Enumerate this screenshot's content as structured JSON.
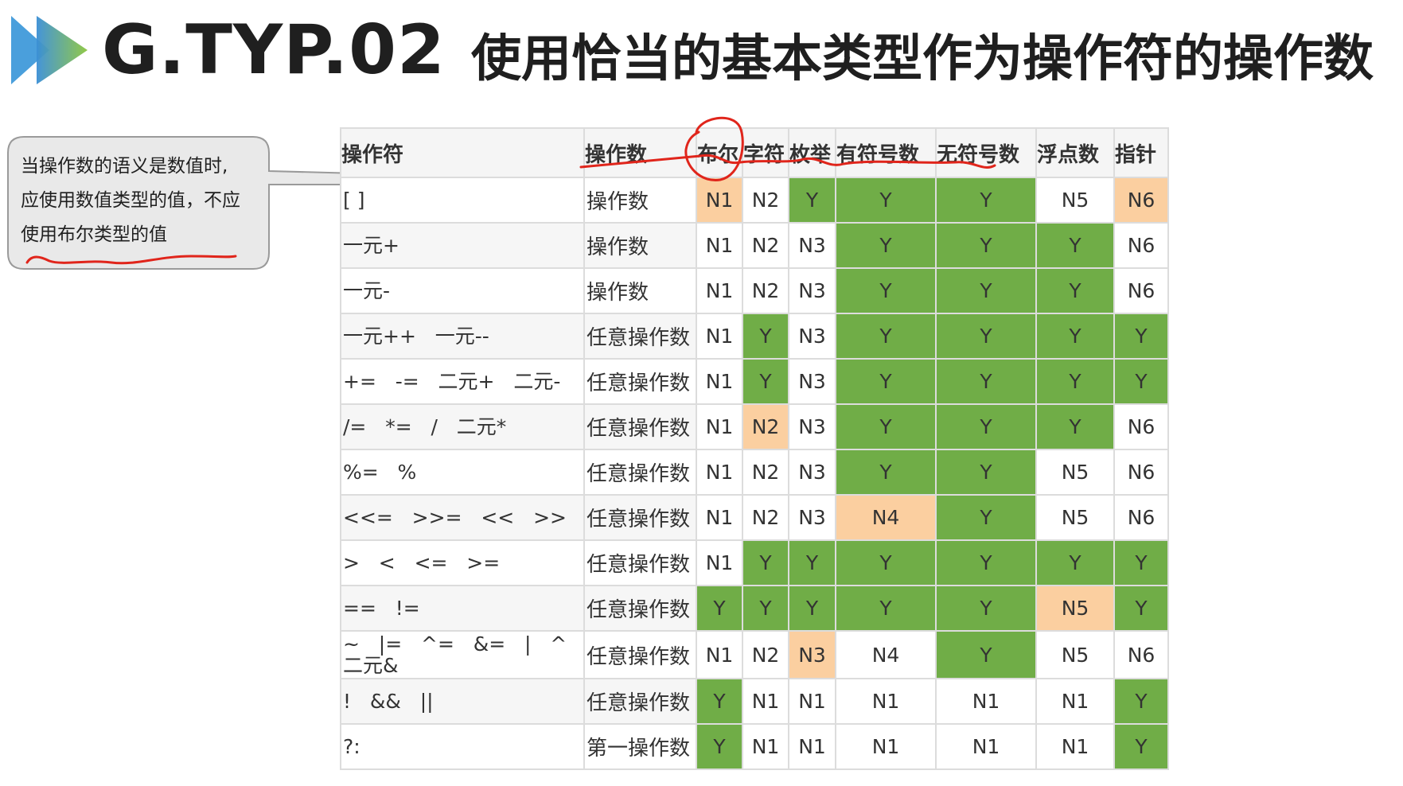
{
  "header": {
    "code": "G.TYP.02",
    "title": "使用恰当的基本类型作为操作符的操作数"
  },
  "callout": {
    "lines": [
      "当操作数的语义是数值时,",
      "应使用数值类型的值，不应",
      "使用布尔类型的值"
    ]
  },
  "colors": {
    "green": "#70ad47",
    "orange": "#fbcfa0",
    "white": "#ffffff",
    "annotation_red": "#e0251b",
    "arrow_gradient_start": "#3b8fd6",
    "arrow_gradient_end": "#8cc63f"
  },
  "table": {
    "headers": [
      "操作符",
      "操作数",
      "布尔",
      "字符",
      "枚举",
      "有符号数",
      "无符号数",
      "浮点数",
      "指针"
    ],
    "rows": [
      {
        "operator": "[ ]",
        "operand": "操作数",
        "cells": [
          {
            "v": "N1",
            "c": "orange"
          },
          {
            "v": "N2",
            "c": "white"
          },
          {
            "v": "Y",
            "c": "green"
          },
          {
            "v": "Y",
            "c": "green"
          },
          {
            "v": "Y",
            "c": "green"
          },
          {
            "v": "N5",
            "c": "white"
          },
          {
            "v": "N6",
            "c": "orange"
          }
        ]
      },
      {
        "operator": "一元+",
        "operand": "操作数",
        "cells": [
          {
            "v": "N1",
            "c": "white"
          },
          {
            "v": "N2",
            "c": "white"
          },
          {
            "v": "N3",
            "c": "white"
          },
          {
            "v": "Y",
            "c": "green"
          },
          {
            "v": "Y",
            "c": "green"
          },
          {
            "v": "Y",
            "c": "green"
          },
          {
            "v": "N6",
            "c": "white"
          }
        ]
      },
      {
        "operator": "一元-",
        "operand": "操作数",
        "cells": [
          {
            "v": "N1",
            "c": "white"
          },
          {
            "v": "N2",
            "c": "white"
          },
          {
            "v": "N3",
            "c": "white"
          },
          {
            "v": "Y",
            "c": "green"
          },
          {
            "v": "Y",
            "c": "green"
          },
          {
            "v": "Y",
            "c": "green"
          },
          {
            "v": "N6",
            "c": "white"
          }
        ]
      },
      {
        "operator": "一元++   一元--",
        "operand": "任意操作数",
        "cells": [
          {
            "v": "N1",
            "c": "white"
          },
          {
            "v": "Y",
            "c": "green"
          },
          {
            "v": "N3",
            "c": "white"
          },
          {
            "v": "Y",
            "c": "green"
          },
          {
            "v": "Y",
            "c": "green"
          },
          {
            "v": "Y",
            "c": "green"
          },
          {
            "v": "Y",
            "c": "green"
          }
        ]
      },
      {
        "operator": "+=   -=   二元+   二元-",
        "operand": "任意操作数",
        "cells": [
          {
            "v": "N1",
            "c": "white"
          },
          {
            "v": "Y",
            "c": "green"
          },
          {
            "v": "N3",
            "c": "white"
          },
          {
            "v": "Y",
            "c": "green"
          },
          {
            "v": "Y",
            "c": "green"
          },
          {
            "v": "Y",
            "c": "green"
          },
          {
            "v": "Y",
            "c": "green"
          }
        ]
      },
      {
        "operator": "/=   *=   /   二元*",
        "operand": "任意操作数",
        "cells": [
          {
            "v": "N1",
            "c": "white"
          },
          {
            "v": "N2",
            "c": "orange"
          },
          {
            "v": "N3",
            "c": "white"
          },
          {
            "v": "Y",
            "c": "green"
          },
          {
            "v": "Y",
            "c": "green"
          },
          {
            "v": "Y",
            "c": "green"
          },
          {
            "v": "N6",
            "c": "white"
          }
        ]
      },
      {
        "operator": "%=   %",
        "operand": "任意操作数",
        "cells": [
          {
            "v": "N1",
            "c": "white"
          },
          {
            "v": "N2",
            "c": "white"
          },
          {
            "v": "N3",
            "c": "white"
          },
          {
            "v": "Y",
            "c": "green"
          },
          {
            "v": "Y",
            "c": "green"
          },
          {
            "v": "N5",
            "c": "white"
          },
          {
            "v": "N6",
            "c": "white"
          }
        ]
      },
      {
        "operator": "<<=   >>=   <<   >>",
        "operand": "任意操作数",
        "cells": [
          {
            "v": "N1",
            "c": "white"
          },
          {
            "v": "N2",
            "c": "white"
          },
          {
            "v": "N3",
            "c": "white"
          },
          {
            "v": "N4",
            "c": "orange"
          },
          {
            "v": "Y",
            "c": "green"
          },
          {
            "v": "N5",
            "c": "white"
          },
          {
            "v": "N6",
            "c": "white"
          }
        ]
      },
      {
        "operator": ">   <   <=   >=",
        "operand": "任意操作数",
        "cells": [
          {
            "v": "N1",
            "c": "white"
          },
          {
            "v": "Y",
            "c": "green"
          },
          {
            "v": "Y",
            "c": "green"
          },
          {
            "v": "Y",
            "c": "green"
          },
          {
            "v": "Y",
            "c": "green"
          },
          {
            "v": "Y",
            "c": "green"
          },
          {
            "v": "Y",
            "c": "green"
          }
        ]
      },
      {
        "operator": "==   !=",
        "operand": "任意操作数",
        "cells": [
          {
            "v": "Y",
            "c": "green"
          },
          {
            "v": "Y",
            "c": "green"
          },
          {
            "v": "Y",
            "c": "green"
          },
          {
            "v": "Y",
            "c": "green"
          },
          {
            "v": "Y",
            "c": "green"
          },
          {
            "v": "N5",
            "c": "orange"
          },
          {
            "v": "Y",
            "c": "green"
          }
        ]
      },
      {
        "operator": "~   |=   ^=   &=   |   ^\n二元&",
        "operand": "任意操作数",
        "cells": [
          {
            "v": "N1",
            "c": "white"
          },
          {
            "v": "N2",
            "c": "white"
          },
          {
            "v": "N3",
            "c": "orange"
          },
          {
            "v": "N4",
            "c": "white"
          },
          {
            "v": "Y",
            "c": "green"
          },
          {
            "v": "N5",
            "c": "white"
          },
          {
            "v": "N6",
            "c": "white"
          }
        ]
      },
      {
        "operator": "!   &&   ||",
        "operand": "任意操作数",
        "cells": [
          {
            "v": "Y",
            "c": "green"
          },
          {
            "v": "N1",
            "c": "white"
          },
          {
            "v": "N1",
            "c": "white"
          },
          {
            "v": "N1",
            "c": "white"
          },
          {
            "v": "N1",
            "c": "white"
          },
          {
            "v": "N1",
            "c": "white"
          },
          {
            "v": "Y",
            "c": "green"
          }
        ]
      },
      {
        "operator": "?:",
        "operand": "第一操作数",
        "cells": [
          {
            "v": "Y",
            "c": "green"
          },
          {
            "v": "N1",
            "c": "white"
          },
          {
            "v": "N1",
            "c": "white"
          },
          {
            "v": "N1",
            "c": "white"
          },
          {
            "v": "N1",
            "c": "white"
          },
          {
            "v": "N1",
            "c": "white"
          },
          {
            "v": "Y",
            "c": "green"
          }
        ]
      }
    ]
  }
}
